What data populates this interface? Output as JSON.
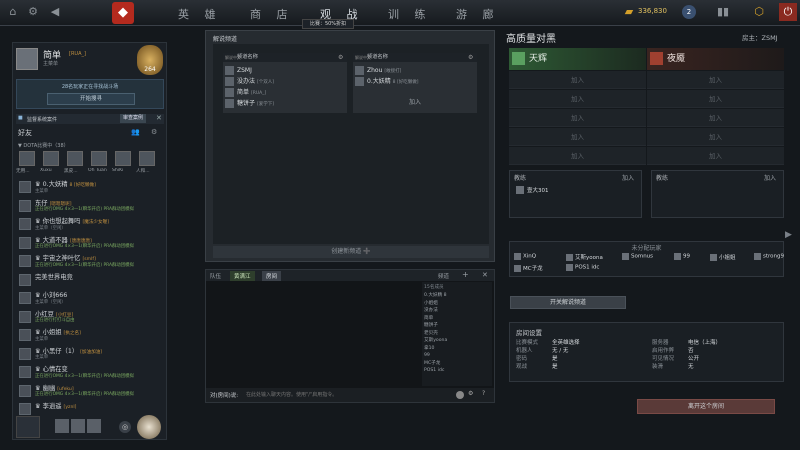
{
  "topbar": {
    "nav": [
      "英 雄",
      "商 店",
      "观 战",
      "训 练",
      "游 廊"
    ],
    "gold": "336,830",
    "notice": "比赛：50%折扣"
  },
  "profile": {
    "name": "简单",
    "tag": "[RUA_]",
    "status": "主菜单",
    "level": "264"
  },
  "invite": {
    "text": "28名玩家正在寻找战斗场",
    "button": "开始搜寻"
  },
  "alert": {
    "label": "监督系统案件",
    "button": "审查案例"
  },
  "friends_label": "好友",
  "dota_group": "▼ DOTA比赛中（38）",
  "party": [
    {
      "name": "无用..."
    },
    {
      "name": "Xuxu"
    },
    {
      "name": "黑皮..."
    },
    {
      "name": "Oh Tuan"
    },
    {
      "name": "ShiKi"
    },
    {
      "name": "人和..."
    }
  ],
  "friends": [
    {
      "name": "♛ 0.大妖精",
      "tag": "8 [好吃懒做]",
      "sub": "主菜单",
      "green": false
    },
    {
      "name": "东仔",
      "tag": "[嗯嗯嗯呢]",
      "sub": "正在进行OMG 4×3—1(瞬华开启) PRA群动团模拟",
      "green": true
    },
    {
      "name": "♛ 你也想起舞吗",
      "tag": "[魔法少女喔]",
      "sub": "主菜单（空闲）",
      "green": false
    },
    {
      "name": "♛ 大道不器",
      "tag": "[唐唐唐唐]",
      "sub": "正在进行OMG 4×3—1(瞬华开启) PRA群动团模拟",
      "green": true
    },
    {
      "name": "♛ 宇宙之神叶忆",
      "tag": "[smlf]",
      "sub": "正在进行OMG 4×3—1(瞬华开启) PRA群动团模拟",
      "green": true
    },
    {
      "name": "完美世界电竞",
      "tag": "",
      "sub": "",
      "green": false
    },
    {
      "name": "♛ 小刘666",
      "tag": "",
      "sub": "主菜单（空闲）",
      "green": false
    },
    {
      "name": "小红豆",
      "tag": "[小红豆]",
      "sub": "正在进行打打斗自由",
      "green": true
    },
    {
      "name": "♛ 小姐姐",
      "tag": "[执之名]",
      "sub": "主菜单",
      "green": false
    },
    {
      "name": "♛ 小黑仔（1）",
      "tag": "[加油加油]",
      "sub": "主菜单",
      "green": false
    },
    {
      "name": "♛ 心情在变",
      "tag": "",
      "sub": "正在进行OMG 4×3—1(瞬华开启) PRA群动团模拟",
      "green": true
    },
    {
      "name": "♛ 幽幽",
      "tag": "[ufeku]",
      "sub": "正在进行OMG 4×3—1(瞬华开启) PRA群动团模拟",
      "green": true
    },
    {
      "name": "♛ 李逍遥",
      "tag": "[yznl]",
      "sub": "",
      "green": false
    }
  ],
  "lobby": {
    "title": "解说频道",
    "col_header": "频道名称",
    "header_small": "解说中文",
    "left": [
      {
        "name": "ZSMJ",
        "tag": ""
      },
      {
        "name": "没办法",
        "tag": "[个双人]"
      },
      {
        "name": "简单",
        "tag": "[RUA_]"
      },
      {
        "name": "糖饼子",
        "tag": "[爱学下]"
      }
    ],
    "right": [
      {
        "name": "Zhou",
        "tag": "[敢接打]"
      },
      {
        "name": "0.大妖精",
        "tag": "8 [好吃懒做]"
      }
    ],
    "join": "加入",
    "create": "创建新频道 ➕"
  },
  "chat": {
    "tabs": [
      "队伍",
      "黄满江",
      "房间"
    ],
    "channel_label": "频道",
    "prefix": "对(房间)说:",
    "placeholder": "在此处输入聊天内容。使用\"/\"启用指令。",
    "members_header": "15名成员",
    "members": [
      "0.大妖精 8",
      "小姐姐",
      "没办法",
      "简单",
      "糖饼子",
      "老贝壳",
      "艾斯yoona",
      "拿10",
      "99",
      "MC子龙",
      "POS1 idc"
    ]
  },
  "room": {
    "title": "高质量对黑",
    "owner": "房主：ZSMJ",
    "radiant": "天辉",
    "dire": "夜魇",
    "join": "加入",
    "coach_label": "教练",
    "coach_left": "壹大301",
    "unassigned_label": "未分配玩家",
    "unassigned": [
      "XinQ",
      "艾斯yoona",
      "Somnus",
      "99",
      "小姐姐",
      "strong9",
      "MC子龙",
      "POS1 idc"
    ],
    "toggle_btn": "开关解说频道",
    "settings_title": "房间设置",
    "settings_left": [
      {
        "k": "比赛模式",
        "v": "全英雄选择"
      },
      {
        "k": "机器人",
        "v": "无 / 无"
      },
      {
        "k": "密码",
        "v": "是"
      },
      {
        "k": "观战",
        "v": "是"
      }
    ],
    "settings_right": [
      {
        "k": "服务器",
        "v": "电信（上海）"
      },
      {
        "k": "启用作弊",
        "v": "否"
      },
      {
        "k": "可见情况",
        "v": "公开"
      },
      {
        "k": "装滑",
        "v": "无"
      }
    ],
    "leave_btn": "离开这个房间"
  }
}
